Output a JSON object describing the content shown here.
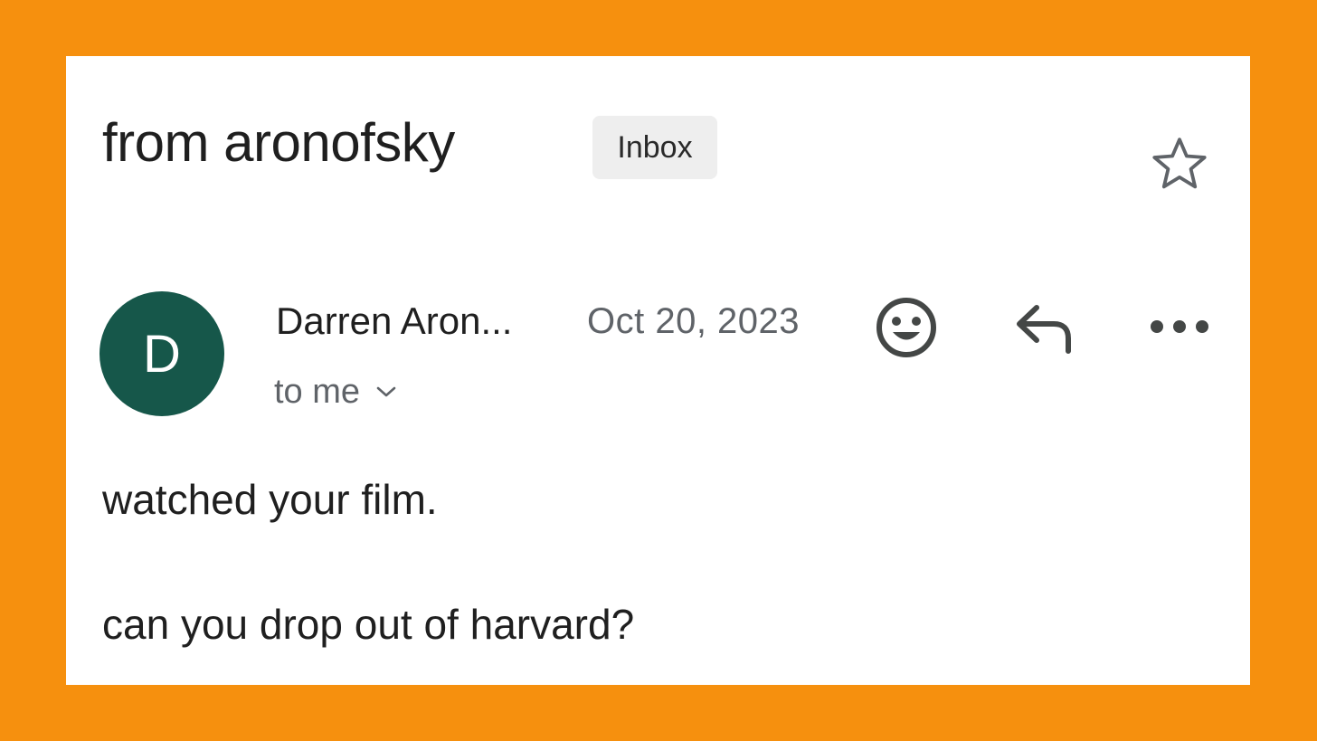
{
  "email": {
    "subject": "from aronofsky",
    "label_badge": "Inbox",
    "starred": false,
    "sender": {
      "initial": "D",
      "name": "Darren Aron...",
      "avatar_color": "#16574a"
    },
    "date": "Oct 20, 2023",
    "recipient": "to me",
    "body": {
      "line1": "watched your film.",
      "line2": "can you drop out of harvard?"
    }
  },
  "icons": {
    "star": "star-outline-icon",
    "emoji": "add-emoji-reaction-icon",
    "reply": "reply-icon",
    "more": "more-horizontal-icon",
    "recipient_expand": "chevron-down-icon"
  },
  "colors": {
    "frame_background": "#f6900e",
    "card_background": "#ffffff",
    "text_primary": "#1f1f1f",
    "text_secondary": "#5f6368",
    "badge_background": "#eeeeee"
  }
}
